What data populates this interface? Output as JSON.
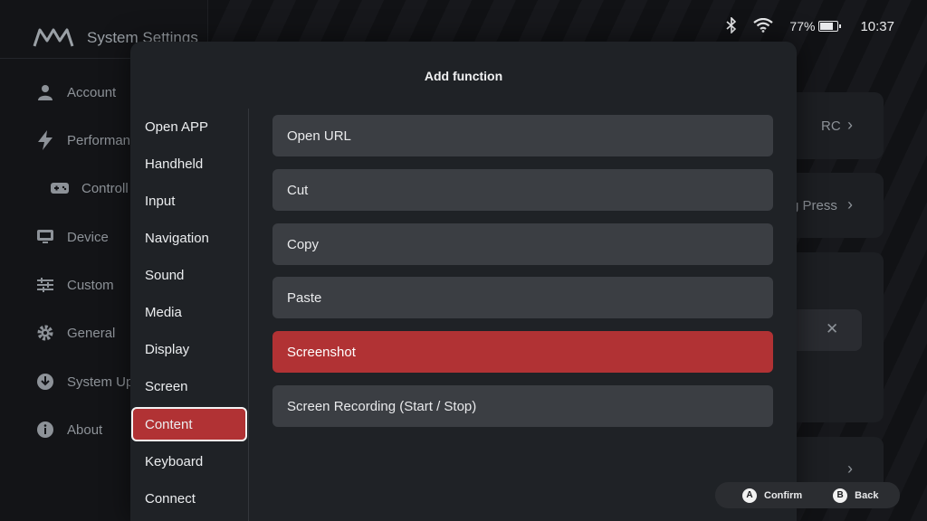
{
  "app": {
    "title": "System Settings"
  },
  "status": {
    "battery": "77%",
    "battery_level": 0.77,
    "time": "10:37"
  },
  "sidebar": {
    "items": [
      {
        "label": "Account",
        "icon": "person-icon"
      },
      {
        "label": "Performan",
        "icon": "lightning-icon"
      },
      {
        "label": "Controll",
        "icon": "gamepad-icon"
      },
      {
        "label": "Device",
        "icon": "device-icon"
      },
      {
        "label": "Custom",
        "icon": "sliders-icon"
      },
      {
        "label": "General",
        "icon": "gear-icon"
      },
      {
        "label": "System Up",
        "icon": "download-icon"
      },
      {
        "label": "About",
        "icon": "info-icon"
      }
    ]
  },
  "background_cards": {
    "card1_text": "RC",
    "card2_text": "g Press"
  },
  "modal": {
    "title": "Add function",
    "categories": [
      "Open APP",
      "Handheld",
      "Input",
      "Navigation",
      "Sound",
      "Media",
      "Display",
      "Screen",
      "Content",
      "Keyboard",
      "Connect"
    ],
    "active_category": "Content",
    "functions": [
      "Open URL",
      "Cut",
      "Copy",
      "Paste",
      "Screenshot",
      "Screen Recording (Start / Stop)"
    ],
    "active_function": "Screenshot"
  },
  "hints": {
    "a_key": "A",
    "a_label": "Confirm",
    "b_key": "B",
    "b_label": "Back"
  },
  "colors": {
    "accent": "#b13234",
    "panel": "#1f2226",
    "item": "#3b3e43"
  }
}
